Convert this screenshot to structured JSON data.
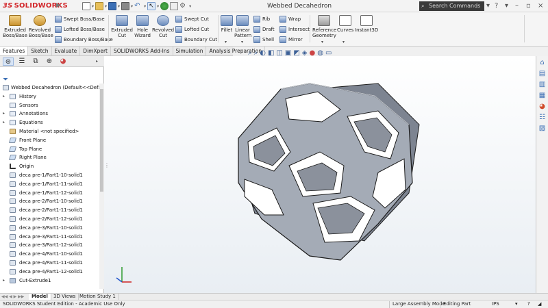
{
  "app": {
    "brand": "SOLIDWORKS",
    "brand_mark": "3S",
    "window_title": "Webbed Decahedron",
    "search_placeholder": "Search Commands"
  },
  "ribbon": {
    "extruded_boss": "Extruded Boss/Base",
    "revolved_boss": "Revolved Boss/Base",
    "swept_boss": "Swept Boss/Base",
    "lofted_boss": "Lofted Boss/Base",
    "boundary_boss": "Boundary Boss/Base",
    "extruded_cut": "Extruded Cut",
    "hole_wizard": "Hole Wizard",
    "revolved_cut": "Revolved Cut",
    "swept_cut": "Swept Cut",
    "lofted_cut": "Lofted Cut",
    "boundary_cut": "Boundary Cut",
    "fillet": "Fillet",
    "linear_pattern": "Linear Pattern",
    "rib": "Rib",
    "draft": "Draft",
    "shell": "Shell",
    "wrap": "Wrap",
    "intersect": "Intersect",
    "mirror": "Mirror",
    "reference_geometry": "Reference Geometry",
    "curves": "Curves",
    "instant3d": "Instant3D"
  },
  "tabs": [
    {
      "label": "Features",
      "active": true
    },
    {
      "label": "Sketch",
      "active": false
    },
    {
      "label": "Evaluate",
      "active": false
    },
    {
      "label": "DimXpert",
      "active": false
    },
    {
      "label": "SOLIDWORKS Add-Ins",
      "active": false
    },
    {
      "label": "Simulation",
      "active": false
    },
    {
      "label": "Analysis Preparation",
      "active": false
    }
  ],
  "tree": {
    "root": "Webbed Decahedron  (Default<<Defa",
    "items": [
      {
        "label": "History",
        "icon": "history-icon",
        "kind": "folder",
        "expand": true
      },
      {
        "label": "Sensors",
        "icon": "sensors-icon",
        "kind": "folder",
        "expand": false
      },
      {
        "label": "Annotations",
        "icon": "annotations-icon",
        "kind": "folder",
        "expand": true
      },
      {
        "label": "Equations",
        "icon": "equations-icon",
        "kind": "folder",
        "expand": true
      },
      {
        "label": "Material <not specified>",
        "icon": "material-icon",
        "kind": "mat",
        "expand": false
      },
      {
        "label": "Front Plane",
        "icon": "plane-icon",
        "kind": "plane",
        "expand": false
      },
      {
        "label": "Top Plane",
        "icon": "plane-icon",
        "kind": "plane",
        "expand": false
      },
      {
        "label": "Right Plane",
        "icon": "plane-icon",
        "kind": "plane",
        "expand": false
      },
      {
        "label": "Origin",
        "icon": "origin-icon",
        "kind": "origin",
        "expand": false
      },
      {
        "label": "deca pre-1/Part1-10-solid1",
        "icon": "part-icon",
        "kind": "part",
        "expand": false
      },
      {
        "label": "deca pre-1/Part1-11-solid1",
        "icon": "part-icon",
        "kind": "part",
        "expand": false
      },
      {
        "label": "deca pre-1/Part1-12-solid1",
        "icon": "part-icon",
        "kind": "part",
        "expand": false
      },
      {
        "label": "deca pre-2/Part1-10-solid1",
        "icon": "part-icon",
        "kind": "part",
        "expand": false
      },
      {
        "label": "deca pre-2/Part1-11-solid1",
        "icon": "part-icon",
        "kind": "part",
        "expand": false
      },
      {
        "label": "deca pre-2/Part1-12-solid1",
        "icon": "part-icon",
        "kind": "part",
        "expand": false
      },
      {
        "label": "deca pre-3/Part1-10-solid1",
        "icon": "part-icon",
        "kind": "part",
        "expand": false
      },
      {
        "label": "deca pre-3/Part1-11-solid1",
        "icon": "part-icon",
        "kind": "part",
        "expand": false
      },
      {
        "label": "deca pre-3/Part1-12-solid1",
        "icon": "part-icon",
        "kind": "part",
        "expand": false
      },
      {
        "label": "deca pre-4/Part1-10-solid1",
        "icon": "part-icon",
        "kind": "part",
        "expand": false
      },
      {
        "label": "deca pre-4/Part1-11-solid1",
        "icon": "part-icon",
        "kind": "part",
        "expand": false
      },
      {
        "label": "deca pre-4/Part1-12-solid1",
        "icon": "part-icon",
        "kind": "part",
        "expand": false
      },
      {
        "label": "Cut-Extrude1",
        "icon": "cut-extrude-icon",
        "kind": "cut",
        "expand": true
      }
    ]
  },
  "bottom_tabs": [
    {
      "label": "Model",
      "active": true
    },
    {
      "label": "3D Views",
      "active": false
    },
    {
      "label": "Motion Study 1",
      "active": false
    }
  ],
  "status": {
    "edition": "SOLIDWORKS Student Edition - Academic Use Only",
    "mode": "Large Assembly Mode",
    "editing": "Editing Part",
    "units": "IPS"
  },
  "colors": {
    "brand_red": "#d2262a",
    "model_face": "#9aa1ad",
    "model_inner": "#5f6470",
    "model_edge": "#1b1b1b"
  }
}
